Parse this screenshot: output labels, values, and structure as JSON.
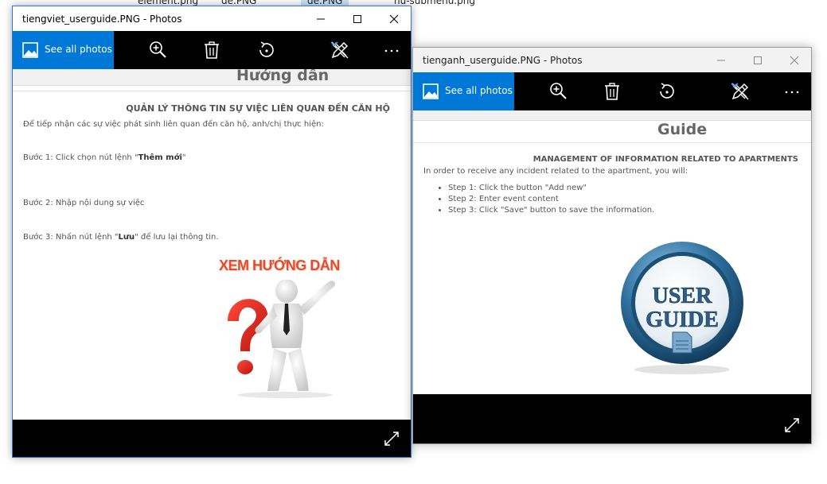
{
  "desktop": {
    "files": [
      "element.png",
      "de.PNG",
      "de.PNG",
      "nu-submenu.png"
    ]
  },
  "window_vi": {
    "title": "tiengviet_userguide.PNG - Photos",
    "see_all": "See all photos",
    "doc": {
      "guide_title": "Hướng dẫn",
      "heading": "QUẢN LÝ THÔNG TIN SỰ VIỆC LIÊN QUAN ĐẾN CĂN HỘ",
      "intro": "Để tiếp nhận các sự việc phát sinh liên quan đến căn hộ, anh/chị thực hiện:",
      "step1_prefix": "Bước 1: Click chọn nút lệnh \"",
      "step1_bold": "Thêm mới",
      "step1_suffix": "\"",
      "step2": "Bước 2: Nhập nội dung sự việc",
      "step3_prefix": "Bước 3: Nhấn nút lệnh \"",
      "step3_bold": "Lưu",
      "step3_suffix": "\" để lưu lại thông tin.",
      "banner": "XEM HƯỚNG DẪN"
    }
  },
  "window_en": {
    "title": "tienganh_userguide.PNG - Photos",
    "see_all": "See all photos",
    "doc": {
      "guide_title": "Guide",
      "heading": "MANAGEMENT OF INFORMATION RELATED TO APARTMENTS",
      "intro": "In order to receive any incident related to the apartment, you will:",
      "steps": [
        "Step 1: Click the button \"Add new\"",
        "Step 2: Enter event content",
        "Step 3: Click \"Save\" button to save the information."
      ],
      "badge_line1": "USER",
      "badge_line2": "GUIDE"
    }
  },
  "colors": {
    "accent": "#0078d7",
    "toolbar": "#000000",
    "banner_red": "#e84a2a",
    "badge_blue": "#2c6e9c"
  },
  "icons": [
    "photos-icon",
    "zoom-in-icon",
    "delete-icon",
    "rotate-icon",
    "edit-icon",
    "chevron-down-icon",
    "more-icon",
    "expand-icon",
    "minimize-icon",
    "maximize-icon",
    "close-icon"
  ]
}
